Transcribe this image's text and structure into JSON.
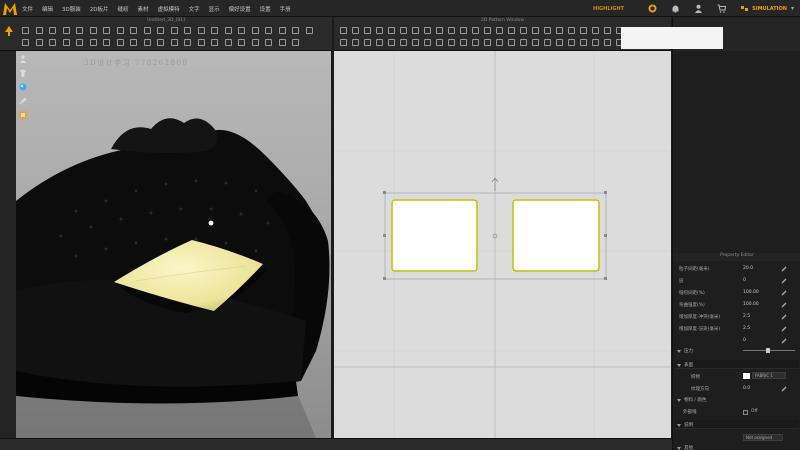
{
  "app": {
    "name": "Marvelous Designer",
    "accent": "#f0a000"
  },
  "menu": {
    "items": [
      "文件",
      "编辑",
      "3D服装",
      "2D板片",
      "缝纫",
      "素材",
      "虚拟模特",
      "文字",
      "显示",
      "偏好设置",
      "设置",
      "手册"
    ]
  },
  "top_right": {
    "highlight_label": "HIGHLIGHT",
    "mode_label": "SIMULATION",
    "icons": [
      "gold-coin-icon",
      "bell-icon",
      "user-icon",
      "cart-icon",
      "mode-switch-icon"
    ]
  },
  "windows": {
    "view3d_title": "Untitled_3D_[01]",
    "view2d_title": "2D Pattern Window"
  },
  "view3d": {
    "watermark": "3D设计学习 778262800",
    "tools": [
      "avatar-icon",
      "garment-icon",
      "sphere-icon",
      "brush-icon",
      "fabric-icon"
    ]
  },
  "patterns": [
    {
      "name": "pattern-left"
    },
    {
      "name": "pattern-right"
    }
  ],
  "property_editor": {
    "title": "Property Editor",
    "rows": [
      {
        "label": "粒子间距(毫米)",
        "value": "20.0"
      },
      {
        "label": "层",
        "value": "0"
      },
      {
        "label": "缝纫间距(%)",
        "value": "100.00"
      },
      {
        "label": "弯曲强度(%)",
        "value": "100.00"
      },
      {
        "label": "增加厚度-冲突(毫米)",
        "value": "2.5"
      },
      {
        "label": "增加厚度-渲染(毫米)",
        "value": "2.5"
      },
      {
        "label": "",
        "value": "0"
      }
    ],
    "shrink_label": "压力",
    "sections": [
      {
        "name": "表面",
        "fields": [
          {
            "label": "织物",
            "value": "FABRIC 1"
          },
          {
            "label": "纹理方向",
            "value": "0.0"
          }
        ]
      },
      {
        "name": "物料 / 颜色"
      },
      {
        "name": "外部线",
        "value": "Off"
      },
      {
        "name": "说明"
      },
      {
        "name": "",
        "dropdown": "Not assigned"
      },
      {
        "name": "其他"
      }
    ]
  }
}
